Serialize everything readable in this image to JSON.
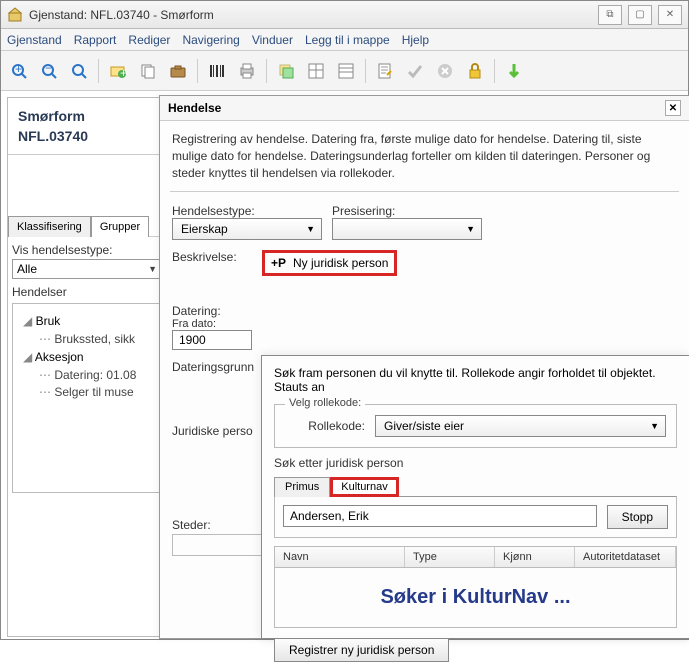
{
  "window": {
    "title": "Gjenstand: NFL.03740  -  Smørform",
    "buttons": {
      "restore": "⧉",
      "max": "▢",
      "close": "✕"
    }
  },
  "menu": {
    "gjenstand": "Gjenstand",
    "rapport": "Rapport",
    "rediger": "Rediger",
    "navigering": "Navigering",
    "vinduer": "Vinduer",
    "legg_til": "Legg til i mappe",
    "hjelp": "Hjelp"
  },
  "object": {
    "name": "Smørform",
    "id": "NFL.03740"
  },
  "left": {
    "tab_klass": "Klassifisering",
    "tab_grupper": "Grupper",
    "vis_label": "Vis hendelsestype:",
    "vis_value": "Alle",
    "hendelser_label": "Hendelser",
    "tree": {
      "bruk": "Bruk",
      "brukssted": "Brukssted, sikk",
      "aksesjon": "Aksesjon",
      "datering": "Datering: 01.08",
      "selger": "Selger til muse"
    }
  },
  "hendelse": {
    "title": "Hendelse",
    "desc": "Registrering av hendelse. Datering fra, første mulige dato for hendelse. Datering til, siste mulige dato for hendelse. Dateringsunderlag forteller om kilden til dateringen. Personer og steder knyttes til hendelsen via rollekoder.",
    "type_label": "Hendelsestype:",
    "type_value": "Eierskap",
    "pres_label": "Presisering:",
    "beskrivelse_label": "Beskrivelse:",
    "ny_person": "Ny juridisk person",
    "datering_label": "Datering:",
    "fra_dato_label": "Fra dato:",
    "fra_dato_value": "1900",
    "dateringsgrunn_label": "Dateringsgrunn",
    "juridiske_label": "Juridiske perso",
    "steder_label": "Steder:"
  },
  "dialog": {
    "desc": "Søk fram personen du vil knytte til. Rollekode angir forholdet til objektet. Stauts an",
    "velg_label": "Velg rollekode:",
    "rollekode_label": "Rollekode:",
    "rollekode_value": "Giver/siste eier",
    "sok_etter_label": "Søk etter juridisk person",
    "tab_primus": "Primus",
    "tab_kulturnav": "Kulturnav",
    "search_value": "Andersen, Erik",
    "stopp": "Stopp",
    "col_navn": "Navn",
    "col_type": "Type",
    "col_kjonn": "Kjønn",
    "col_auth": "Autoritetdataset",
    "searching": "Søker i KulturNav ...",
    "registrer": "Registrer ny juridisk person"
  },
  "icons": {
    "zoom_in": "🔍+",
    "zoom_out": "🔍−",
    "zoom_reset": "🔍",
    "folder_add": "📁+",
    "copy": "📄",
    "brief": "💼",
    "barcode": "▮▮",
    "print": "🖨",
    "layer": "🗂",
    "grid1": "▦",
    "grid2": "▤",
    "note": "📝",
    "check": "✔",
    "cancel": "⊘",
    "lock": "🔒",
    "down": "↓"
  }
}
